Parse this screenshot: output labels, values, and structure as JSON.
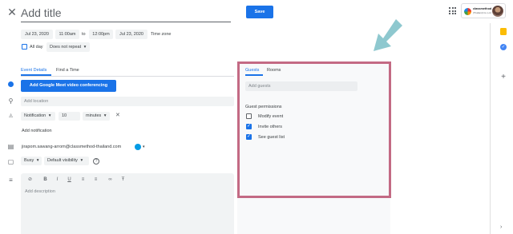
{
  "header": {
    "close_icon": "close-icon",
    "title_placeholder": "Add title",
    "save_label": "Save",
    "apps_icon": "apps-grid-icon",
    "org": {
      "name": "classmethod",
      "subtitle": "(Thailand) Co.,Ltd"
    }
  },
  "datetime": {
    "start_date": "Jul 23, 2020",
    "start_time": "11:00am",
    "to_label": "to",
    "end_time": "12:00pm",
    "end_date": "Jul 23, 2020",
    "timezone_label": "Time zone"
  },
  "allday": {
    "label": "All day",
    "checked": false,
    "repeat": "Does not repeat",
    "repeat_caret": "▾"
  },
  "left_tabs": [
    {
      "label": "Event Details",
      "active": true
    },
    {
      "label": "Find a Time",
      "active": false
    }
  ],
  "details": {
    "meet_button": "Add Google Meet video conferencing",
    "location_placeholder": "Add location",
    "notification": {
      "type": "Notification",
      "type_caret": "▾",
      "value": "10",
      "unit": "minutes",
      "unit_caret": "▾",
      "remove": "✕"
    },
    "add_notification": "Add notification",
    "calendar_owner": "jirapom.sawang-arrom@classmethod-thailand.com",
    "color_caret": "▾",
    "busy": "Busy",
    "busy_caret": "▾",
    "visibility": "Default visibility",
    "visibility_caret": "▾",
    "help": "?",
    "description_placeholder": "Add description",
    "toolbar": {
      "attach": "⌀",
      "bold": "B",
      "italic": "I",
      "underline": "U",
      "numbered": "≡",
      "bulleted": "≡",
      "link": "⊃",
      "clear": "T̶"
    }
  },
  "icons": {
    "meet": "meet-icon",
    "location": "⚲",
    "bell": "🔔",
    "calendar": "▤",
    "briefcase": "▢",
    "description": "≡"
  },
  "guests_panel": {
    "tabs": [
      {
        "label": "Guests",
        "active": true
      },
      {
        "label": "Rooms",
        "active": false
      }
    ],
    "add_guests_placeholder": "Add guests",
    "permissions_title": "Guest permissions",
    "permissions": [
      {
        "label": "Modify event",
        "checked": false
      },
      {
        "label": "Invite others",
        "checked": true
      },
      {
        "label": "See guest list",
        "checked": true
      }
    ],
    "check_glyph": "✓"
  },
  "right_rail": {
    "plus": "+",
    "blue_icon": "✓",
    "chevron": "›"
  },
  "colors": {
    "accent": "#1a73e8",
    "highlight_border": "#c36a84",
    "arrow": "#8ec8cf",
    "field_bg": "#f1f3f4"
  }
}
